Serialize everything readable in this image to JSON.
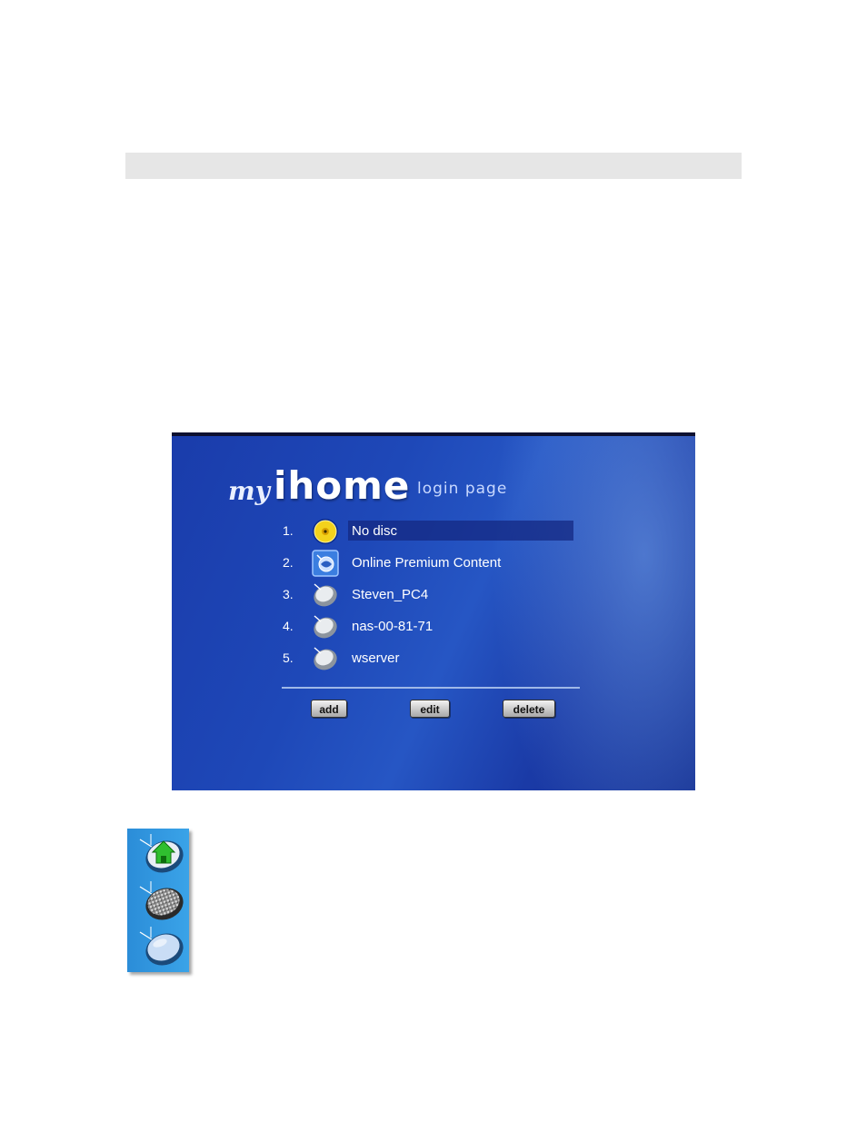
{
  "header_bar": {},
  "screen": {
    "logo": {
      "my": "my",
      "ihome": "ihome",
      "subtitle": "login page"
    },
    "items": [
      {
        "num": "1.",
        "label": "No disc",
        "icon": "disc-icon",
        "selected": true
      },
      {
        "num": "2.",
        "label": "Online Premium Content",
        "icon": "globe-icon",
        "selected": false
      },
      {
        "num": "3.",
        "label": "Steven_PC4",
        "icon": "server-icon",
        "selected": false
      },
      {
        "num": "4.",
        "label": "nas-00-81-71",
        "icon": "server-icon",
        "selected": false
      },
      {
        "num": "5.",
        "label": "wserver",
        "icon": "server-icon",
        "selected": false
      }
    ],
    "buttons": {
      "add": "add",
      "edit": "edit",
      "delete": "delete"
    }
  },
  "sidebar_icons": [
    "home-icon",
    "textured-stone-icon",
    "blank-stone-icon"
  ],
  "colors": {
    "screen_bg": "#1e48b8",
    "highlight": "#14287f",
    "strip": "#3aa3e8",
    "home_arrow": "#2fbf2f"
  }
}
